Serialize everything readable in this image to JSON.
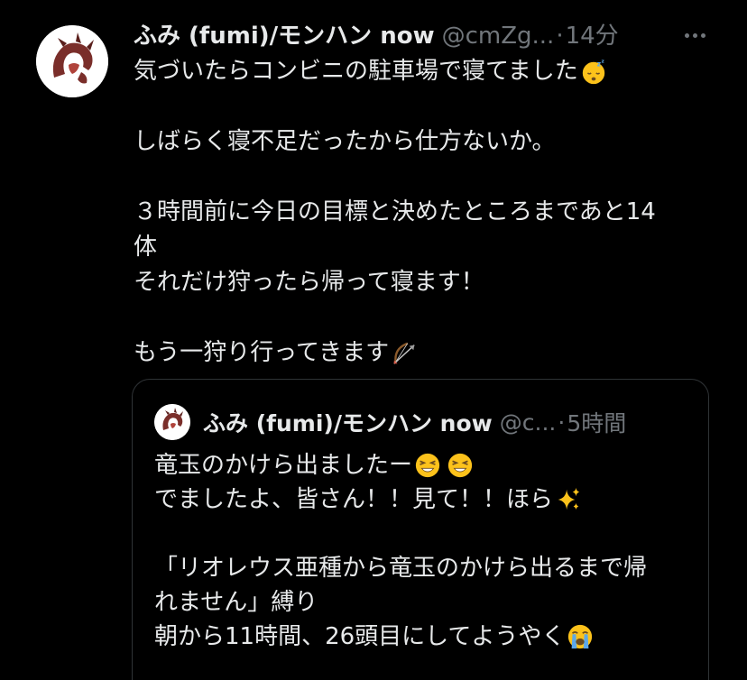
{
  "tweet": {
    "display_name": "ふみ (fumi)/モンハン now",
    "handle": "@cmZg...",
    "separator": "·",
    "time": "14分",
    "lines": [
      "気づいたらコンビニの駐車場で寝てました",
      "",
      "しばらく寝不足だったから仕方ないか。",
      "",
      "３時間前に今日の目標と決めたところまであと14",
      "体",
      "それだけ狩ったら帰って寝ます！",
      "",
      "もう一狩り行ってきます"
    ],
    "emojis": {
      "line0": "sleeping-face-emoji",
      "line8": "bow-and-arrow-emoji"
    }
  },
  "quote": {
    "display_name": "ふみ (fumi)/モンハン now",
    "handle": "@c...",
    "separator": "·",
    "time": "5時間",
    "lines": [
      "竜玉のかけら出ましたー",
      "でましたよ、皆さん！！見て！！ほら",
      "",
      "「リオレウス亜種から竜玉のかけら出るまで帰",
      "れません」縛り",
      "朝から11時間、26頭目にしてようやく"
    ],
    "emojis": {
      "line0": "grinning-squinting-face-emoji",
      "line1": "sparkles-emoji",
      "line5": "loudly-crying-face-emoji"
    }
  },
  "colors": {
    "background": "#000000",
    "text_primary": "#e7e9ea",
    "text_secondary": "#71767b",
    "border": "#2f3336"
  }
}
